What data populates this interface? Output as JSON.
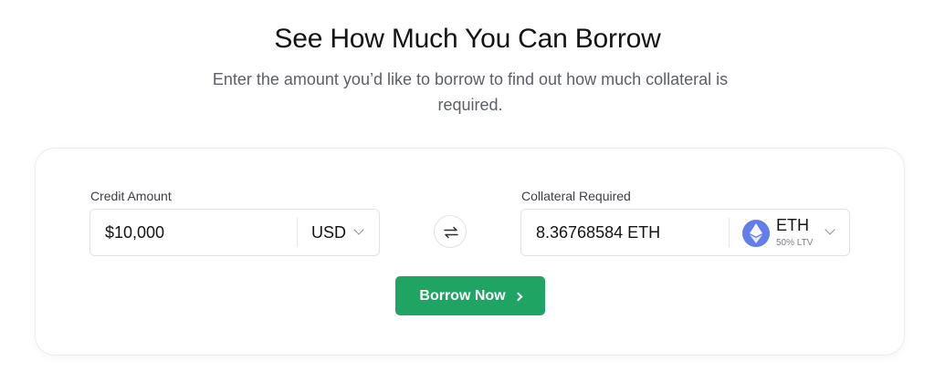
{
  "header": {
    "title": "See How Much You Can Borrow",
    "subtitle": "Enter the amount you’d like to borrow to find out how much collateral is required."
  },
  "credit": {
    "label": "Credit Amount",
    "value": "$10,000",
    "currency": "USD"
  },
  "collateral": {
    "label": "Collateral Required",
    "value": "8.36768584 ETH",
    "asset_symbol": "ETH",
    "asset_ltv": "50% LTV"
  },
  "cta": {
    "label": "Borrow Now"
  },
  "icons": {
    "swap": "swap-arrows-icon",
    "asset": "ethereum-icon",
    "chevrons": "chevron-down-icon"
  },
  "colors": {
    "primary_button": "#1fa463",
    "eth_badge": "#627eea",
    "border": "#e1e3e6"
  }
}
